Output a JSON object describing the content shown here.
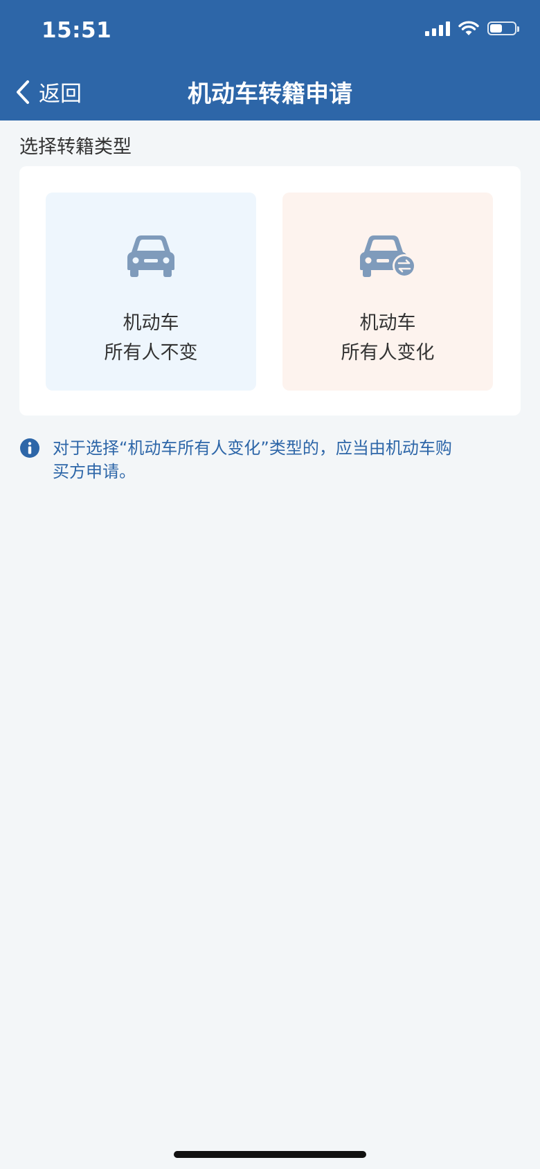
{
  "status_bar": {
    "time": "15:51",
    "battery_level": 0.5
  },
  "nav": {
    "back_label": "返回",
    "title": "机动车转籍申请"
  },
  "section_label": "选择转籍类型",
  "options": [
    {
      "line1": "机动车",
      "line2": "所有人不变",
      "icon": "car-icon"
    },
    {
      "line1": "机动车",
      "line2": "所有人变化",
      "icon": "car-transfer-icon"
    }
  ],
  "notice": {
    "icon": "info-icon",
    "text": "对于选择“机动车所有人变化”类型的，应当由机动车购买方申请。"
  },
  "colors": {
    "header_bg": "#2d66a8",
    "page_bg": "#f3f6f8",
    "option_left_bg": "#eef6fd",
    "option_right_bg": "#fdf3ee",
    "icon_color": "#7f9bbb",
    "notice_text": "#2d66a8"
  }
}
